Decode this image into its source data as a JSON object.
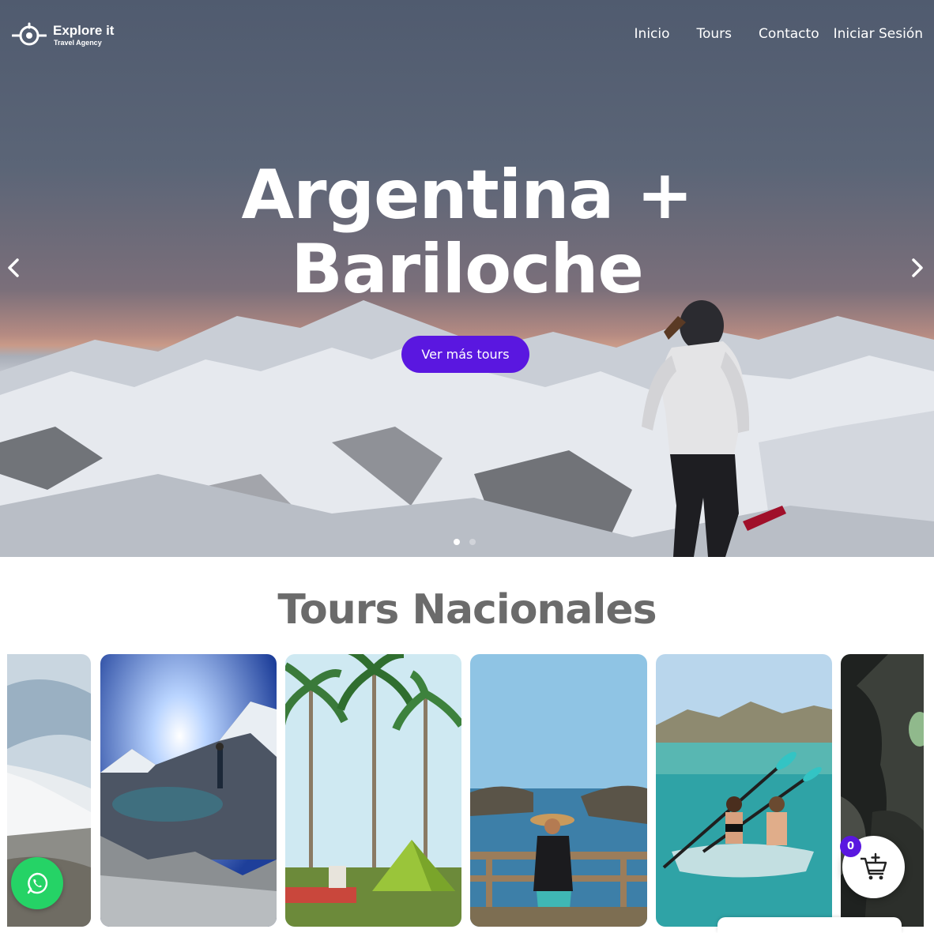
{
  "brand": {
    "name": "Explore it",
    "tagline": "Travel Agency"
  },
  "nav": {
    "items": [
      {
        "label": "Inicio"
      },
      {
        "label": "Tours"
      },
      {
        "label": "Contacto"
      },
      {
        "label": "Iniciar Sesión"
      }
    ]
  },
  "hero": {
    "title_line1": "Argentina +",
    "title_line2": "Bariloche",
    "cta_label": "Ver más tours",
    "slides_total": 2,
    "active_slide": 1,
    "icons": {
      "prev": "chevron-left-icon",
      "next": "chevron-right-icon"
    }
  },
  "tours": {
    "heading": "Tours Nacionales",
    "cards": [
      {
        "scene": "snow-volcano"
      },
      {
        "scene": "mountain-lagoon"
      },
      {
        "scene": "palm-camping"
      },
      {
        "scene": "ocean-cliffs"
      },
      {
        "scene": "kayak-bay"
      },
      {
        "scene": "cave"
      }
    ]
  },
  "floating": {
    "whatsapp_icon": "whatsapp-icon",
    "cart_icon": "cart-add-icon",
    "cart_count": "0"
  },
  "colors": {
    "accent": "#5a17e0",
    "whatsapp": "#25d366",
    "heading": "#6b6b6b"
  }
}
